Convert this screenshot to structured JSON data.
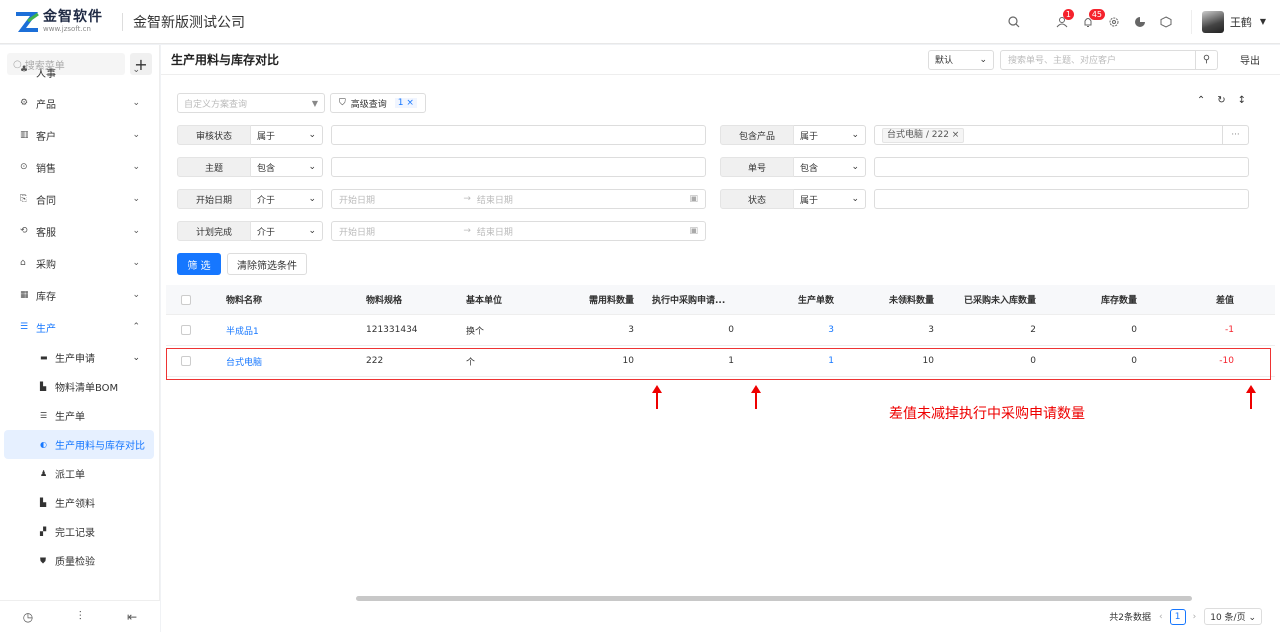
{
  "header": {
    "logo_name": "金智软件",
    "logo_url": "www.jzsoft.cn",
    "company": "金智新版测试公司",
    "mail_badge": "1",
    "bell_badge": "45",
    "user_name": "王鹤"
  },
  "sidebar": {
    "search_placeholder": "搜索菜单",
    "items": [
      {
        "label": "人事",
        "icon": "♣"
      },
      {
        "label": "产品",
        "icon": "⚙"
      },
      {
        "label": "客户",
        "icon": "▥"
      },
      {
        "label": "销售",
        "icon": "⊙"
      },
      {
        "label": "合同",
        "icon": "⎘"
      },
      {
        "label": "客服",
        "icon": "⟲"
      },
      {
        "label": "采购",
        "icon": "⌂"
      },
      {
        "label": "库存",
        "icon": "▦"
      },
      {
        "label": "生产",
        "icon": "☰"
      }
    ],
    "sub_items": [
      {
        "label": "生产申请",
        "icon": "▬"
      },
      {
        "label": "物料清单BOM",
        "icon": "▙"
      },
      {
        "label": "生产单",
        "icon": "☰"
      },
      {
        "label": "生产用料与库存对比",
        "icon": "◐"
      },
      {
        "label": "派工单",
        "icon": "♟"
      },
      {
        "label": "生产领料",
        "icon": "▙"
      },
      {
        "label": "完工记录",
        "icon": "▞"
      },
      {
        "label": "质量检验",
        "icon": "⛊"
      }
    ]
  },
  "page": {
    "title": "生产用料与库存对比",
    "view_select": "默认",
    "search_placeholder": "搜索单号、主题、对应客户",
    "export": "导出"
  },
  "filters": {
    "scheme_placeholder": "自定义方案查询",
    "advanced_label": "高级查询",
    "advanced_count": "1 ×",
    "review_status": {
      "label": "审核状态",
      "op": "属于"
    },
    "contain_product": {
      "label": "包含产品",
      "op": "属于",
      "tag": "台式电脑 / 222 ×"
    },
    "subject": {
      "label": "主题",
      "op": "包含"
    },
    "order_no": {
      "label": "单号",
      "op": "包含"
    },
    "start_date": {
      "label": "开始日期",
      "op": "介于",
      "from": "开始日期",
      "to": "结束日期"
    },
    "status": {
      "label": "状态",
      "op": "属于"
    },
    "plan_done": {
      "label": "计划完成",
      "op": "介于",
      "from": "开始日期",
      "to": "结束日期"
    },
    "filter_btn": "筛 选",
    "clear_btn": "清除筛选条件"
  },
  "table": {
    "columns": [
      "物料名称",
      "物料规格",
      "基本单位",
      "需用料数量",
      "执行中采购申请...",
      "生产单数",
      "未领料数量",
      "已采购未入库数量",
      "库存数量",
      "差值"
    ],
    "rows": [
      {
        "name": "半成品1",
        "spec": "121331434",
        "unit": "换个",
        "need": "3",
        "exec": "0",
        "prod": "3",
        "unrec": "3",
        "purch": "2",
        "stock": "0",
        "diff": "-1"
      },
      {
        "name": "台式电脑",
        "spec": "222",
        "unit": "个",
        "need": "10",
        "exec": "1",
        "prod": "1",
        "unrec": "10",
        "purch": "0",
        "stock": "0",
        "diff": "-10"
      }
    ]
  },
  "annotation": {
    "note": "差值未减掉执行中采购申请数量"
  },
  "pager": {
    "total": "共2条数据",
    "current": "1",
    "page_size": "10 条/页"
  },
  "colors": {
    "accent": "#1677ff",
    "danger": "#f5222d",
    "annotation": "#e00000"
  }
}
